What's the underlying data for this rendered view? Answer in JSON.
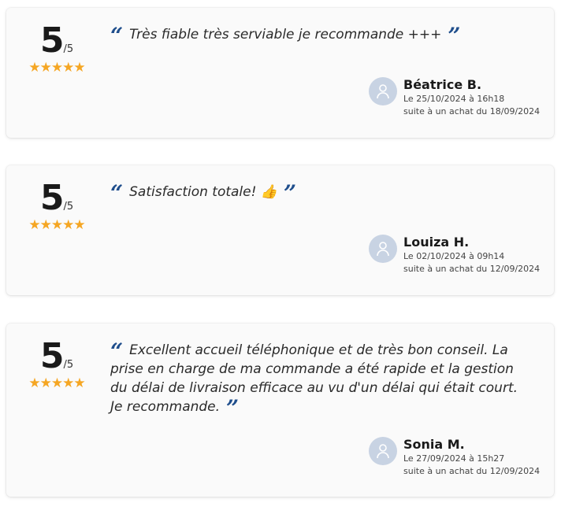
{
  "reviews": [
    {
      "score": "5",
      "out_of": "/5",
      "stars": "★★★★★",
      "text": "Très fiable très serviable je recommande +++",
      "name": "Béatrice B.",
      "date": "Le 25/10/2024 à 16h18",
      "purchase": "suite à un achat du 18/09/2024"
    },
    {
      "score": "5",
      "out_of": "/5",
      "stars": "★★★★★",
      "text": "Satisfaction totale! 👍",
      "name": "Louiza H.",
      "date": "Le 02/10/2024 à 09h14",
      "purchase": "suite à un achat du 12/09/2024"
    },
    {
      "score": "5",
      "out_of": "/5",
      "stars": "★★★★★",
      "text": "Excellent accueil téléphonique et de très bon conseil. La prise en charge de ma commande a été rapide et la gestion du délai de livraison efficace au vu d'un délai qui était court. Je recommande.",
      "name": "Sonia M.",
      "date": "Le 27/09/2024 à 15h27",
      "purchase": "suite à un achat du 12/09/2024"
    }
  ],
  "quote_open": "“",
  "quote_close": "”",
  "colors": {
    "star": "#f5a623",
    "quote_mark": "#1f4e8c",
    "avatar_bg": "#c8d3e3",
    "card_bg": "#fafafa"
  }
}
